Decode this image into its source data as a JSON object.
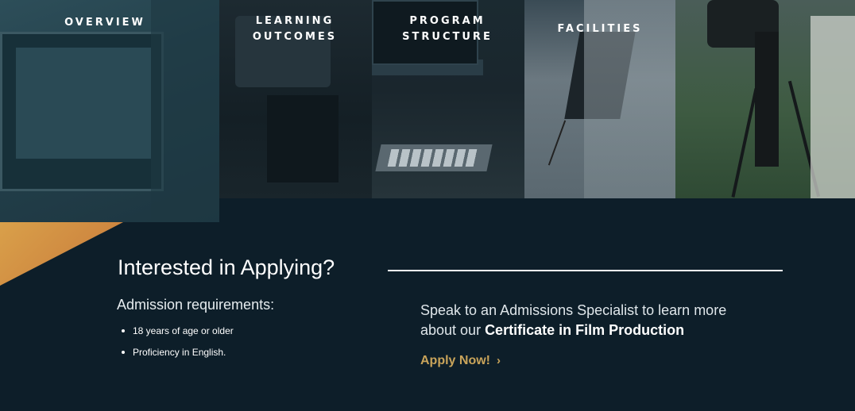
{
  "nav": {
    "overview": "OVERVIEW",
    "learning_1": "LEARNING",
    "learning_2": "OUTCOMES",
    "program_1": "PROGRAM",
    "program_2": "STRUCTURE",
    "facilities": "FACILITIES"
  },
  "cta": {
    "title": "Interested in Applying?",
    "requirements_label": "Admission requirements:",
    "requirements": [
      "18 years of age or older",
      "Proficiency in English."
    ],
    "speak_text": "Speak to an Admissions Specialist to learn more about our ",
    "program_name": "Certificate in Film Production",
    "apply_label": "Apply Now!",
    "apply_icon": "chevron-right-icon"
  },
  "colors": {
    "background": "#0d1e29",
    "accent_gold": "#c9a45a",
    "wedge_orange": "#d9a04a"
  }
}
